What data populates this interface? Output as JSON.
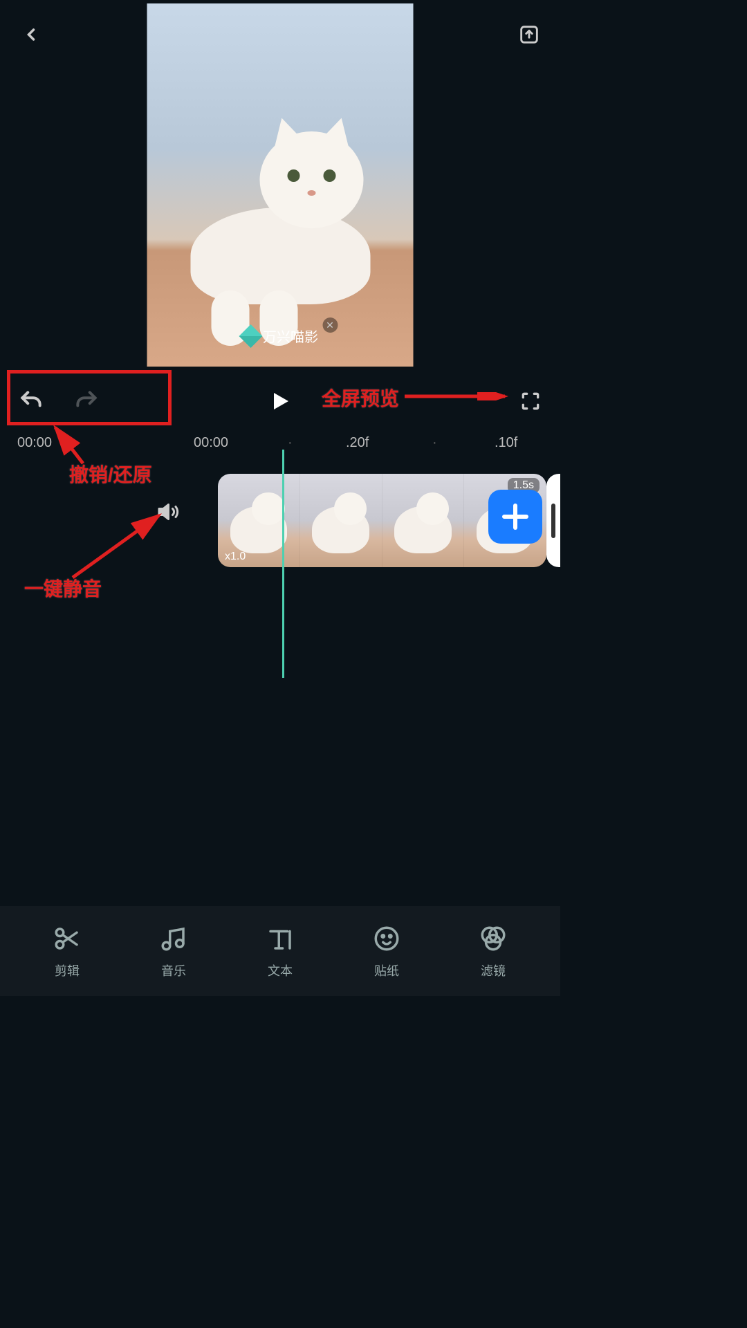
{
  "watermark": {
    "text": "万兴喵影"
  },
  "controls": {
    "time_current": "00:00",
    "time_playhead": "00:00",
    "frame_marker_1": ".20f",
    "frame_marker_2": ".10f"
  },
  "clip": {
    "duration_label": "1.5s",
    "speed_label": "x1.0"
  },
  "tabs": [
    {
      "label": "剪辑"
    },
    {
      "label": "音乐"
    },
    {
      "label": "文本"
    },
    {
      "label": "贴纸"
    },
    {
      "label": "滤镜"
    }
  ],
  "annotations": {
    "undo_redo": "撤销/还原",
    "fullscreen": "全屏预览",
    "mute": "一键静音"
  }
}
